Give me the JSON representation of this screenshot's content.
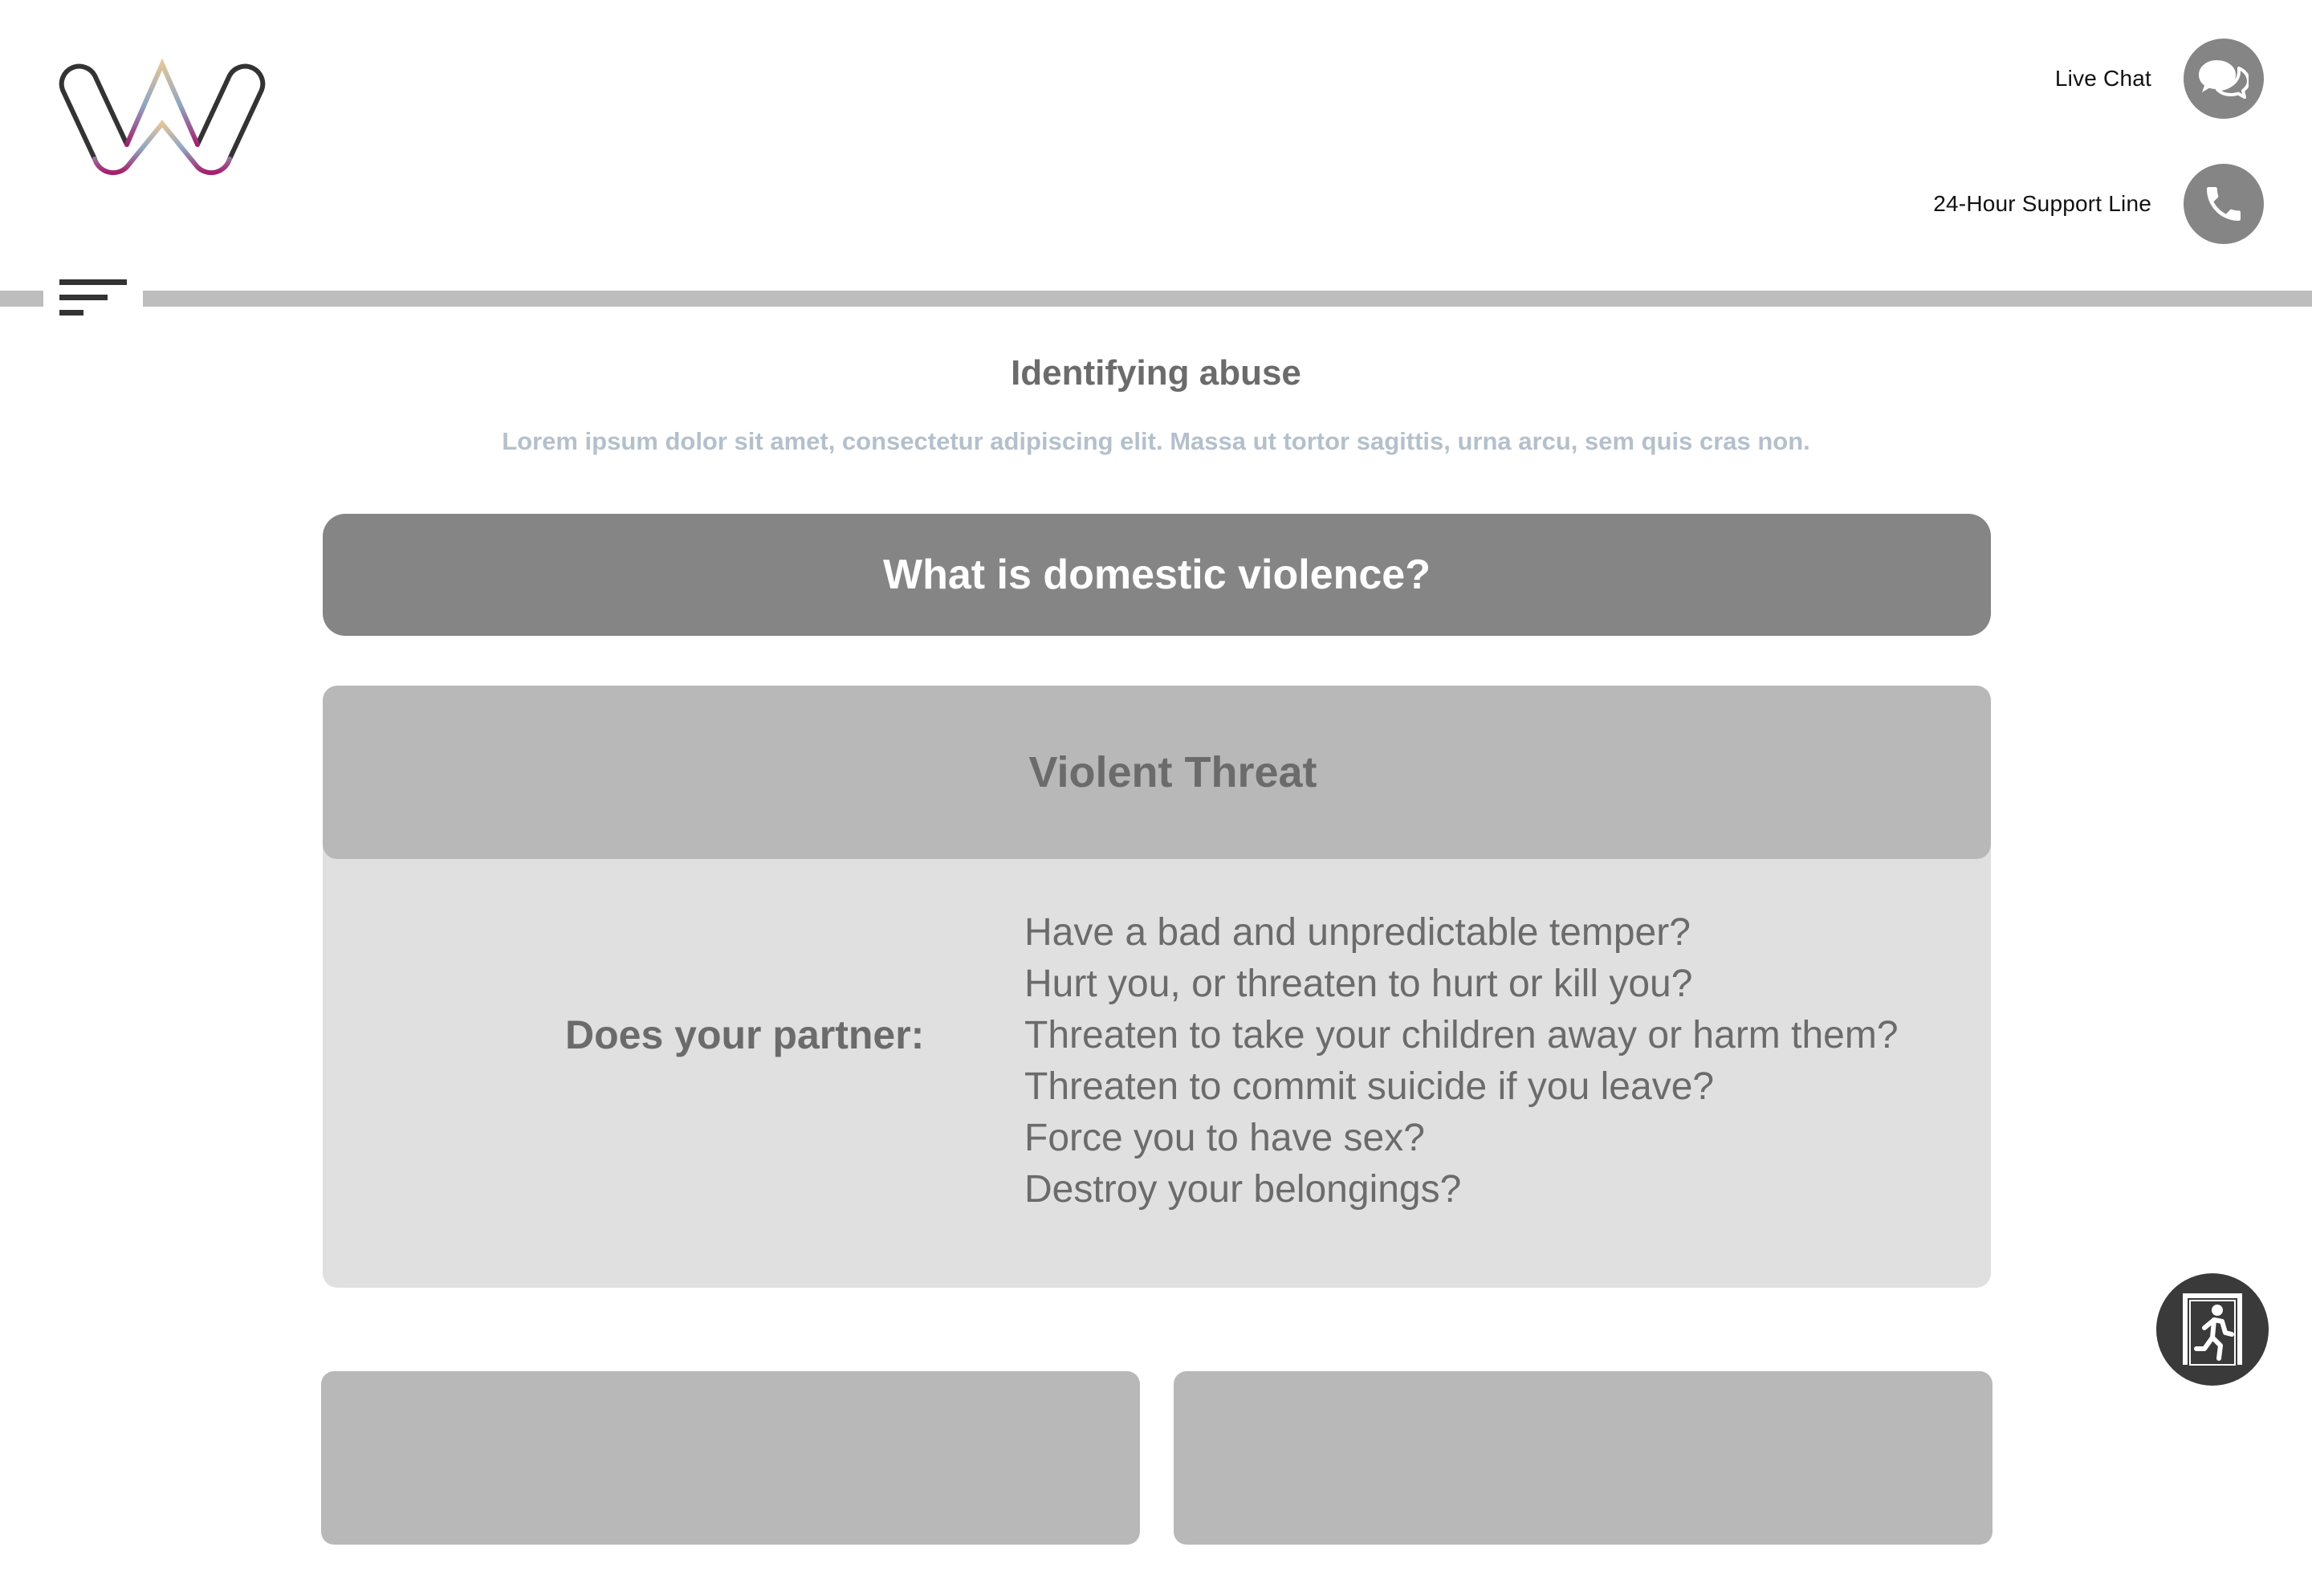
{
  "header": {
    "logo": "w-logo",
    "live_chat": {
      "label": "Live Chat",
      "icon": "chat-bubbles-icon"
    },
    "support_line": {
      "label": "24-Hour Support Line",
      "icon": "phone-icon"
    }
  },
  "nav": {
    "menu_icon": "hamburger-menu-icon"
  },
  "page": {
    "title": "Identifying abuse",
    "subtitle": "Lorem ipsum dolor sit amet, consectetur adipiscing elit. Massa ut tortor sagittis, urna arcu, sem quis cras non."
  },
  "banner": {
    "label": "What is domestic violence?"
  },
  "card": {
    "title": "Violent Threat",
    "prompt": "Does your partner:",
    "questions": [
      "Have a bad and unpredictable temper?",
      "Hurt you, or threaten to hurt or kill you?",
      "Threaten to take your children away or harm them?",
      "Threaten to commit suicide if you leave?",
      "Force you to have sex?",
      "Destroy your belongings?"
    ]
  },
  "quick_exit": {
    "icon": "emergency-exit-icon"
  },
  "colors": {
    "header_circle": "#858585",
    "banner": "#858585",
    "card_header": "#b8b8b8",
    "card_body": "#e0e0e0",
    "subtitle": "#b4c0cc",
    "quick_exit": "#3a3a3a"
  }
}
